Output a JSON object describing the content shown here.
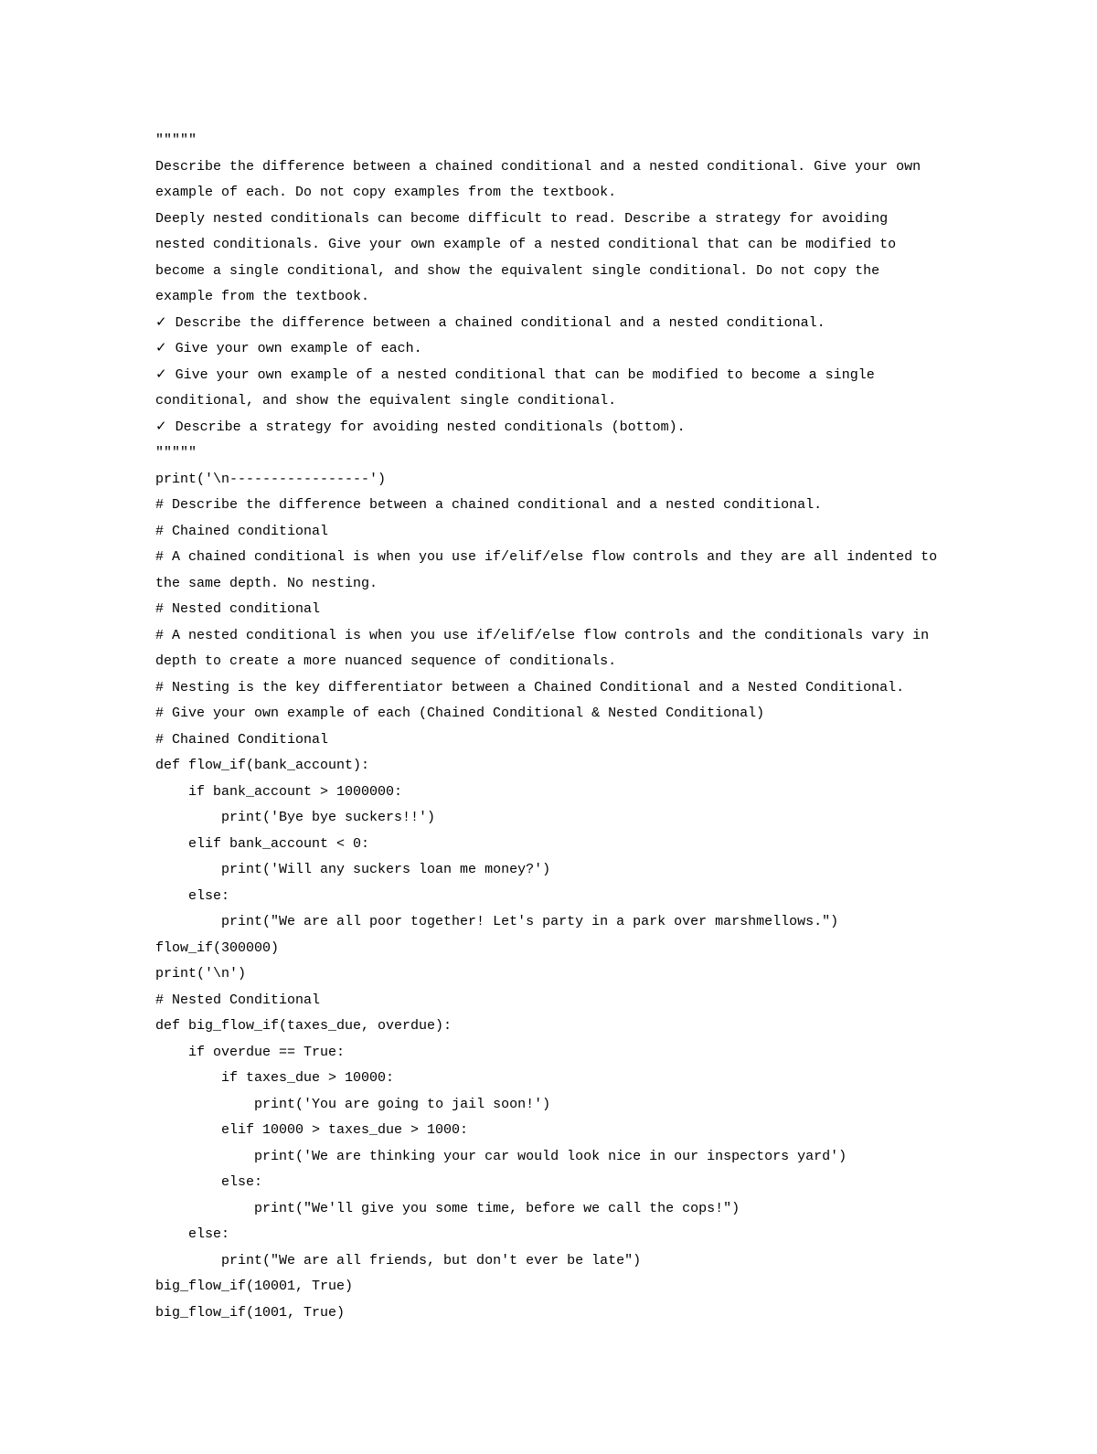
{
  "lines": [
    "\"\"\"\"\"",
    "Describe the difference between a chained conditional and a nested conditional. Give your own example of each. Do not copy examples from the textbook.",
    "Deeply nested conditionals can become difficult to read. Describe a strategy for avoiding nested conditionals. Give your own example of a nested conditional that can be modified to become a single conditional, and show the equivalent single conditional. Do not copy the example from the textbook.",
    "✓ Describe the difference between a chained conditional and a nested conditional.",
    "✓ Give your own example of each.",
    "✓ Give your own example of a nested conditional that can be modified to become a single conditional, and show the equivalent single conditional.",
    "✓ Describe a strategy for avoiding nested conditionals (bottom).",
    "\"\"\"\"\"",
    "print('\\n-----------------')",
    "# Describe the difference between a chained conditional and a nested conditional.",
    "# Chained conditional",
    "# A chained conditional is when you use if/elif/else flow controls and they are all indented to the same depth. No nesting.",
    "# Nested conditional",
    "# A nested conditional is when you use if/elif/else flow controls and the conditionals vary in depth to create a more nuanced sequence of conditionals.",
    "# Nesting is the key differentiator between a Chained Conditional and a Nested Conditional.",
    "# Give your own example of each (Chained Conditional & Nested Conditional)",
    "# Chained Conditional",
    "def flow_if(bank_account):",
    "    if bank_account > 1000000:",
    "        print('Bye bye suckers!!')",
    "    elif bank_account < 0:",
    "        print('Will any suckers loan me money?')",
    "    else:",
    "        print(\"We are all poor together! Let's party in a park over marshmellows.\")",
    "flow_if(300000)",
    "print('\\n')",
    "# Nested Conditional",
    "def big_flow_if(taxes_due, overdue):",
    "    if overdue == True:",
    "        if taxes_due > 10000:",
    "            print('You are going to jail soon!')",
    "        elif 10000 > taxes_due > 1000:",
    "            print('We are thinking your car would look nice in our inspectors yard')",
    "        else:",
    "            print(\"We'll give you some time, before we call the cops!\")",
    "    else:",
    "        print(\"We are all friends, but don't ever be late\")",
    "big_flow_if(10001, True)",
    "big_flow_if(1001, True)"
  ]
}
